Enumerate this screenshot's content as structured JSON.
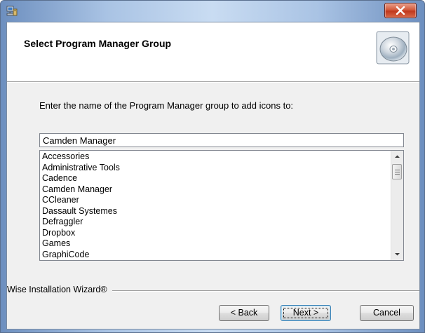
{
  "window": {
    "icon": "setup-computer-icon",
    "close_icon": "close-icon",
    "accent": "#c0381c"
  },
  "header": {
    "title": "Select Program Manager Group",
    "icon": "cd-disc-icon"
  },
  "main": {
    "instruction": "Enter the name of the Program Manager group to add  icons to:",
    "group_input": {
      "value": "Camden Manager"
    },
    "groups_list": [
      "Accessories",
      "Administrative Tools",
      "Cadence",
      "Camden Manager",
      "CCleaner",
      "Dassault Systemes",
      "Defraggler",
      "Dropbox",
      "Games",
      "GraphiCode"
    ]
  },
  "footer": {
    "brand": "Wise Installation Wizard®",
    "back_label": "< Back",
    "next_label": "Next >",
    "cancel_label": "Cancel"
  }
}
